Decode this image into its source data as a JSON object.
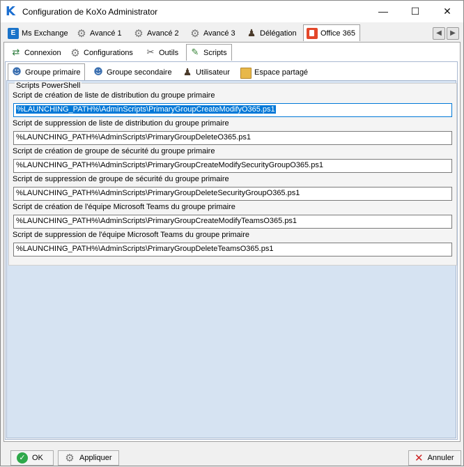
{
  "window": {
    "title": "Configuration de KoXo Administrator",
    "app_icon_glyph": "K",
    "minimize_glyph": "—",
    "maximize_glyph": "☐",
    "close_glyph": "✕"
  },
  "top_tabs": [
    {
      "label": "Ms Exchange",
      "icon": "exchange-icon",
      "glyph": "E"
    },
    {
      "label": "Avancé 1",
      "icon": "gear-icon",
      "glyph": "⚙"
    },
    {
      "label": "Avancé 2",
      "icon": "gear-icon",
      "glyph": "⚙"
    },
    {
      "label": "Avancé 3",
      "icon": "gear-icon",
      "glyph": "⚙"
    },
    {
      "label": "Délégation",
      "icon": "user-icon",
      "glyph": "♟"
    },
    {
      "label": "Office 365",
      "icon": "office-icon",
      "glyph": "",
      "active": true
    }
  ],
  "nav": {
    "prev_glyph": "◀",
    "next_glyph": "▶"
  },
  "sub_tabs": [
    {
      "label": "Connexion",
      "glyph": "⇄"
    },
    {
      "label": "Configurations",
      "glyph": "⚙"
    },
    {
      "label": "Outils",
      "glyph": "✂"
    },
    {
      "label": "Scripts",
      "glyph": "✎",
      "active": true
    }
  ],
  "inner_tabs": [
    {
      "label": "Groupe primaire",
      "glyph": "☻",
      "active": true
    },
    {
      "label": "Groupe secondaire",
      "glyph": "☻"
    },
    {
      "label": "Utilisateur",
      "glyph": "♟"
    },
    {
      "label": "Espace partagé",
      "glyph": ""
    }
  ],
  "group": {
    "legend": "Scripts PowerShell",
    "fields": [
      {
        "label": "Script de création de liste de distribution du groupe primaire",
        "value": "%LAUNCHING_PATH%\\AdminScripts\\PrimaryGroupCreateModifyO365.ps1",
        "selected": true
      },
      {
        "label": "Script de suppression de liste de distribution du groupe primaire",
        "value": "%LAUNCHING_PATH%\\AdminScripts\\PrimaryGroupDeleteO365.ps1"
      },
      {
        "label": "Script de création de groupe de sécurité du groupe primaire",
        "value": "%LAUNCHING_PATH%\\AdminScripts\\PrimaryGroupCreateModifySecurityGroupO365.ps1"
      },
      {
        "label": "Script de suppression de groupe de sécurité du groupe primaire",
        "value": "%LAUNCHING_PATH%\\AdminScripts\\PrimaryGroupDeleteSecurityGroupO365.ps1"
      },
      {
        "label": "Script de création de l'équipe Microsoft Teams du groupe primaire",
        "value": "%LAUNCHING_PATH%\\AdminScripts\\PrimaryGroupCreateModifyTeamsO365.ps1"
      },
      {
        "label": "Script de suppression de l'équipe Microsoft Teams du groupe primaire",
        "value": "%LAUNCHING_PATH%\\AdminScripts\\PrimaryGroupDeleteTeamsO365.ps1"
      }
    ]
  },
  "buttons": {
    "ok": {
      "label": "OK",
      "glyph": "✓"
    },
    "apply": {
      "label": "Appliquer",
      "glyph": "⚙"
    },
    "cancel": {
      "label": "Annuler",
      "glyph": "✕"
    }
  },
  "colors": {
    "accent": "#0078d7",
    "panel_bg": "#d6e3f2",
    "office_red": "#e3472a"
  }
}
